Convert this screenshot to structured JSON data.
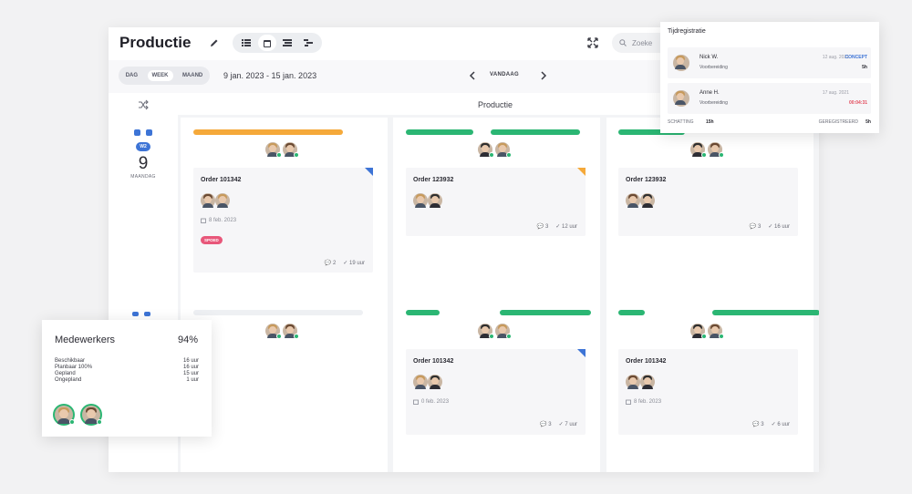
{
  "header": {
    "title": "Productie",
    "search_placeholder": "Zoeke"
  },
  "subbar": {
    "ranges": [
      "DAG",
      "WEEK",
      "MAAND"
    ],
    "active_range": "WEEK",
    "date_range": "9 jan. 2023 - 15 jan. 2023",
    "today_label": "VANDAAG"
  },
  "column_title": "Productie",
  "day": {
    "week_badge": "W2",
    "number": "9",
    "name": "MAANDAG"
  },
  "cards": {
    "c1_top": {
      "title": "Order 101342",
      "date": "8 feb. 2023",
      "tag": "SPOED",
      "comments": "2",
      "hours": "19 uur"
    },
    "c2_top": {
      "title": "Order 123932",
      "comments": "3",
      "hours": "12 uur"
    },
    "c3_top": {
      "title": "Order 123932",
      "comments": "3",
      "hours": "16 uur"
    },
    "c2_bottom": {
      "title": "Order 101342",
      "date": "0 feb. 2023",
      "comments": "3",
      "hours": "7 uur"
    },
    "c3_bottom": {
      "title": "Order 101342",
      "date": "8 feb. 2023",
      "comments": "3",
      "hours": "6 uur"
    }
  },
  "time_popup": {
    "title": "Tijdregistratie",
    "entries": [
      {
        "name": "Nick W.",
        "task": "Voorbereiding",
        "date": "12 aug. 2021",
        "status": "CONCEPT",
        "status_color": "#3d74d6",
        "hours": "5h"
      },
      {
        "name": "Anne H.",
        "task": "Voorbereiding",
        "date": "17 aug. 2021",
        "status": "00:04:31",
        "status_color": "#e24b5c",
        "hours": ""
      }
    ],
    "estimate_label": "SCHATTING",
    "estimate_value": "15h",
    "logged_label": "GEREGISTREERD",
    "logged_value": "5h"
  },
  "staff_popup": {
    "title": "Medewerkers",
    "percent": "94%",
    "rows": [
      {
        "label": "Beschikbaar",
        "value": "16 uur"
      },
      {
        "label": "Planbaar 100%",
        "value": "16 uur"
      },
      {
        "label": "Gepland",
        "value": "15 uur"
      },
      {
        "label": "Ongepland",
        "value": "1 uur"
      }
    ]
  },
  "colors": {
    "accent_blue": "#3d74d6",
    "green": "#2bb673",
    "orange": "#f5a93a",
    "red": "#e8577a"
  },
  "progress": {
    "c1_top": 0.88,
    "c2_top_a": 0.38,
    "c2_top_b": 0.5,
    "c3_top_a": 0.37,
    "c3_top_red": 0.55,
    "c2_bottom_a": 0.19,
    "c2_bottom_b": 0.51,
    "c3_bottom_a": 0.15,
    "c3_bottom_b": 0.6
  }
}
